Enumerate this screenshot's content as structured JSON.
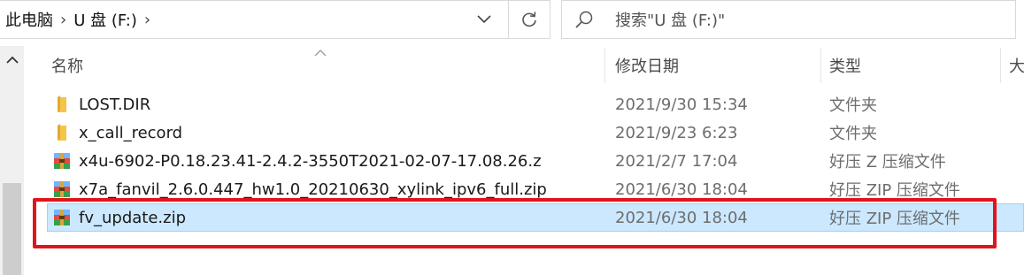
{
  "address": {
    "crumbs": [
      "此电脑",
      "U 盘 (F:)"
    ],
    "separator": "›"
  },
  "search": {
    "placeholder": "搜索\"U 盘 (F:)\""
  },
  "columns": {
    "name": "名称",
    "date": "修改日期",
    "type": "类型",
    "size": "大"
  },
  "files": [
    {
      "name": "LOST.DIR",
      "date": "2021/9/30 15:34",
      "type": "文件夹",
      "icon": "folder-icon",
      "selected": false
    },
    {
      "name": "x_call_record",
      "date": "2021/9/23 6:23",
      "type": "文件夹",
      "icon": "folder-icon",
      "selected": false
    },
    {
      "name": "x4u-6902-P0.18.23.41-2.4.2-3550T2021-02-07-17.08.26.z",
      "date": "2021/2/7 17:04",
      "type": "好压 Z 压缩文件",
      "icon": "archive-icon",
      "selected": false
    },
    {
      "name": "x7a_fanvil_2.6.0.447_hw1.0_20210630_xylink_ipv6_full.zip",
      "date": "2021/6/30 18:04",
      "type": "好压 ZIP 压缩文件",
      "icon": "archive-icon",
      "selected": false
    },
    {
      "name": "fv_update.zip",
      "date": "2021/6/30 18:04",
      "type": "好压 ZIP 压缩文件",
      "icon": "archive-icon",
      "selected": true
    }
  ],
  "colors": {
    "selection": "#cce8ff",
    "selection_border": "#99d1ff",
    "annotation": "#e0141d",
    "folder": "#f4c54b"
  }
}
